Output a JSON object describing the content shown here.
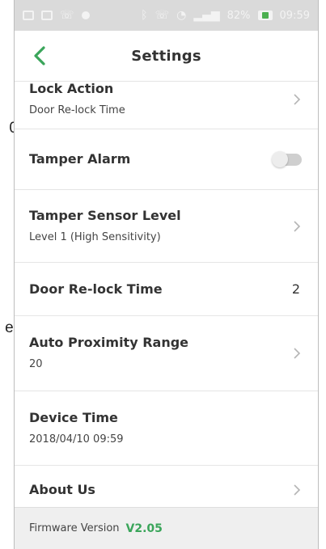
{
  "background_fragments": [
    "0",
    "e,"
  ],
  "status_bar": {
    "battery_text": "82%",
    "time": "09:59"
  },
  "header": {
    "title": "Settings"
  },
  "rows": [
    {
      "title": "Lock Action",
      "subtitle": "Door Re-lock Time",
      "control": "chevron"
    },
    {
      "title": "Tamper Alarm",
      "control": "toggle",
      "toggle_on": false
    },
    {
      "title": "Tamper Sensor Level",
      "subtitle": "Level 1 (High Sensitivity)",
      "control": "chevron"
    },
    {
      "title": "Door Re-lock Time",
      "value": "2",
      "control": "value"
    },
    {
      "title": "Auto Proximity Range",
      "subtitle": "20",
      "control": "chevron"
    },
    {
      "title": "Device Time",
      "subtitle": "2018/04/10  09:59",
      "control": "none"
    },
    {
      "title": "About Us",
      "control": "chevron"
    }
  ],
  "footer": {
    "label": "Firmware Version",
    "version": "V2.05"
  },
  "colors": {
    "accent_green": "#3aa55a",
    "status_bar": "#dadada",
    "footer_bg": "#efefef"
  }
}
